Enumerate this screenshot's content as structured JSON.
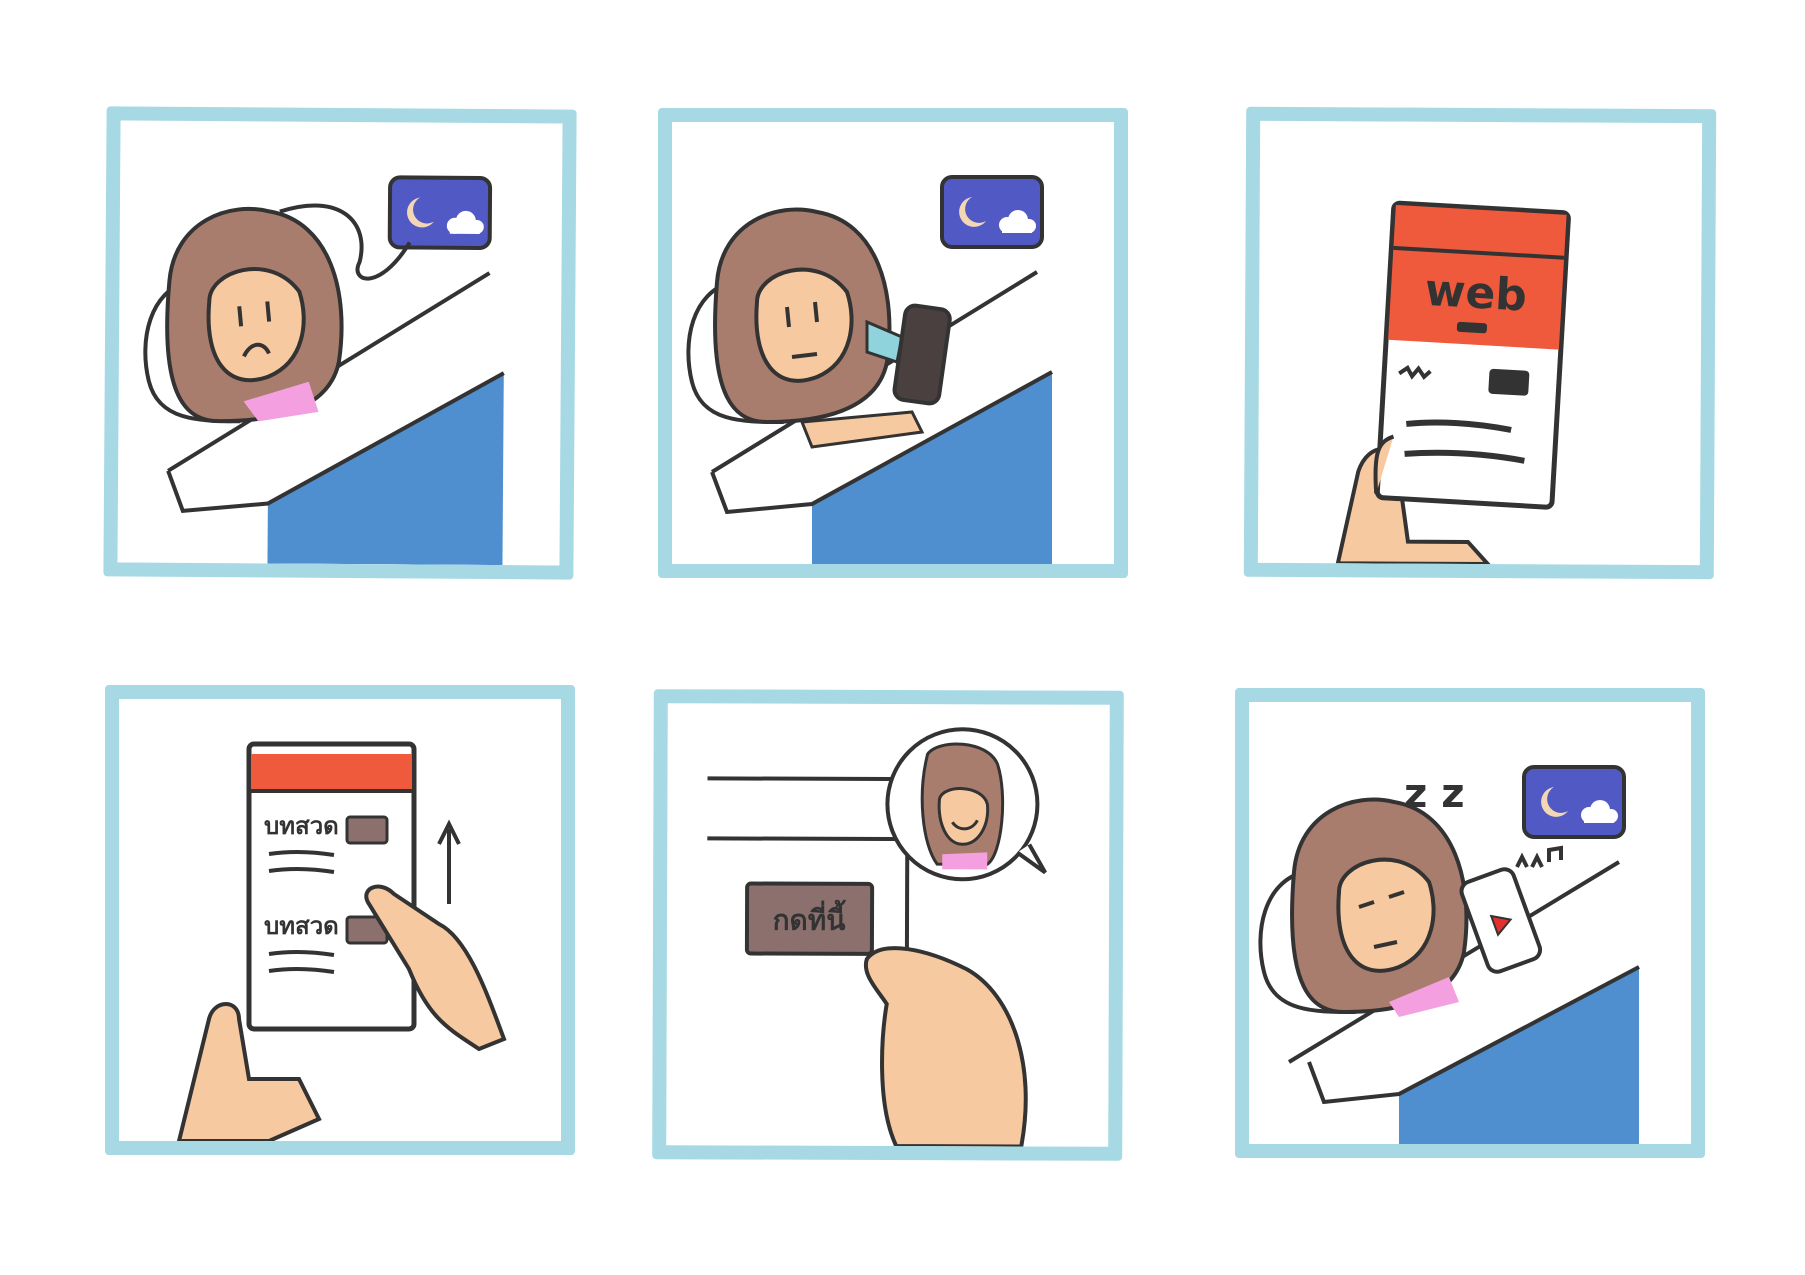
{
  "panels": [
    {
      "id": 1
    },
    {
      "id": 2
    },
    {
      "id": 3,
      "phone_title": "web"
    },
    {
      "id": 4,
      "list_item_1": "บทสวด",
      "list_item_2": "บทสวด"
    },
    {
      "id": 5,
      "button_label": "กดที่นี้"
    },
    {
      "id": 6,
      "sleep_text": "z z"
    }
  ],
  "colors": {
    "frame": "#a6d9e4",
    "hair": "#a97d6e",
    "skin": "#f7c9a0",
    "shirt": "#f4a0e0",
    "blanket": "#4f8ecf",
    "night_sign": "#5159c4",
    "web_header": "#f05a3c",
    "button": "#8c706e",
    "outline": "#333333"
  },
  "icons": [
    "moon-icon",
    "cloud-icon",
    "phone-icon",
    "arrow-up-icon",
    "play-icon",
    "music-notes-icon"
  ]
}
